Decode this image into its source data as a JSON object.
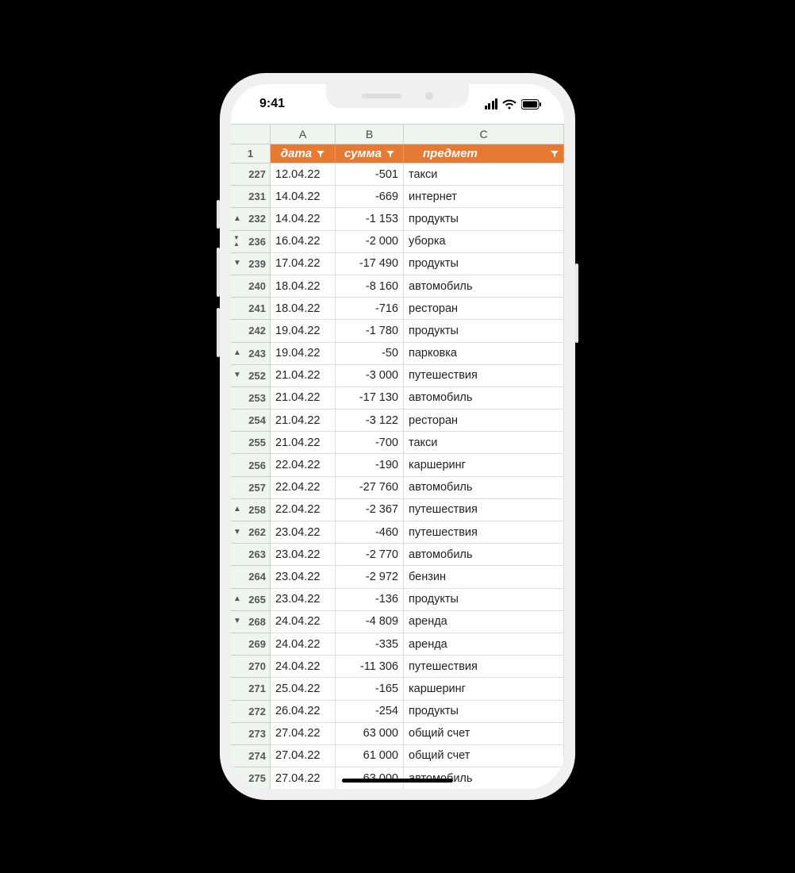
{
  "status": {
    "time": "9:41"
  },
  "columns": {
    "A": "A",
    "B": "B",
    "C": "C"
  },
  "header": {
    "rownum": "1",
    "date": "дата",
    "sum": "сумма",
    "subject": "предмет"
  },
  "rows": [
    {
      "n": "227",
      "marker": "",
      "a": "12.04.22",
      "b": "-501",
      "c": "такси"
    },
    {
      "n": "231",
      "marker": "",
      "a": "14.04.22",
      "b": "-669",
      "c": "интернет"
    },
    {
      "n": "232",
      "marker": "up",
      "a": "14.04.22",
      "b": "-1 153",
      "c": "продукты"
    },
    {
      "n": "236",
      "marker": "both",
      "a": "16.04.22",
      "b": "-2 000",
      "c": "уборка"
    },
    {
      "n": "239",
      "marker": "down",
      "a": "17.04.22",
      "b": "-17 490",
      "c": "продукты"
    },
    {
      "n": "240",
      "marker": "",
      "a": "18.04.22",
      "b": "-8 160",
      "c": "автомобиль"
    },
    {
      "n": "241",
      "marker": "",
      "a": "18.04.22",
      "b": "-716",
      "c": "ресторан"
    },
    {
      "n": "242",
      "marker": "",
      "a": "19.04.22",
      "b": "-1 780",
      "c": "продукты"
    },
    {
      "n": "243",
      "marker": "up",
      "a": "19.04.22",
      "b": "-50",
      "c": "парковка"
    },
    {
      "n": "252",
      "marker": "down",
      "a": "21.04.22",
      "b": "-3 000",
      "c": "путешествия"
    },
    {
      "n": "253",
      "marker": "",
      "a": "21.04.22",
      "b": "-17 130",
      "c": "автомобиль"
    },
    {
      "n": "254",
      "marker": "",
      "a": "21.04.22",
      "b": "-3 122",
      "c": "ресторан"
    },
    {
      "n": "255",
      "marker": "",
      "a": "21.04.22",
      "b": "-700",
      "c": "такси"
    },
    {
      "n": "256",
      "marker": "",
      "a": "22.04.22",
      "b": "-190",
      "c": "каршеринг"
    },
    {
      "n": "257",
      "marker": "",
      "a": "22.04.22",
      "b": "-27 760",
      "c": "автомобиль"
    },
    {
      "n": "258",
      "marker": "up",
      "a": "22.04.22",
      "b": "-2 367",
      "c": "путешествия"
    },
    {
      "n": "262",
      "marker": "down",
      "a": "23.04.22",
      "b": "-460",
      "c": "путешествия"
    },
    {
      "n": "263",
      "marker": "",
      "a": "23.04.22",
      "b": "-2 770",
      "c": "автомобиль"
    },
    {
      "n": "264",
      "marker": "",
      "a": "23.04.22",
      "b": "-2 972",
      "c": "бензин"
    },
    {
      "n": "265",
      "marker": "up",
      "a": "23.04.22",
      "b": "-136",
      "c": "продукты"
    },
    {
      "n": "268",
      "marker": "down",
      "a": "24.04.22",
      "b": "-4 809",
      "c": "аренда"
    },
    {
      "n": "269",
      "marker": "",
      "a": "24.04.22",
      "b": "-335",
      "c": "аренда"
    },
    {
      "n": "270",
      "marker": "",
      "a": "24.04.22",
      "b": "-11 306",
      "c": "путешествия"
    },
    {
      "n": "271",
      "marker": "",
      "a": "25.04.22",
      "b": "-165",
      "c": "каршеринг"
    },
    {
      "n": "272",
      "marker": "",
      "a": "26.04.22",
      "b": "-254",
      "c": "продукты"
    },
    {
      "n": "273",
      "marker": "",
      "a": "27.04.22",
      "b": "63 000",
      "c": "общий счет"
    },
    {
      "n": "274",
      "marker": "",
      "a": "27.04.22",
      "b": "61 000",
      "c": "общий счет"
    },
    {
      "n": "275",
      "marker": "",
      "a": "27.04.22",
      "b": "63 000",
      "c": "автомобиль"
    }
  ]
}
